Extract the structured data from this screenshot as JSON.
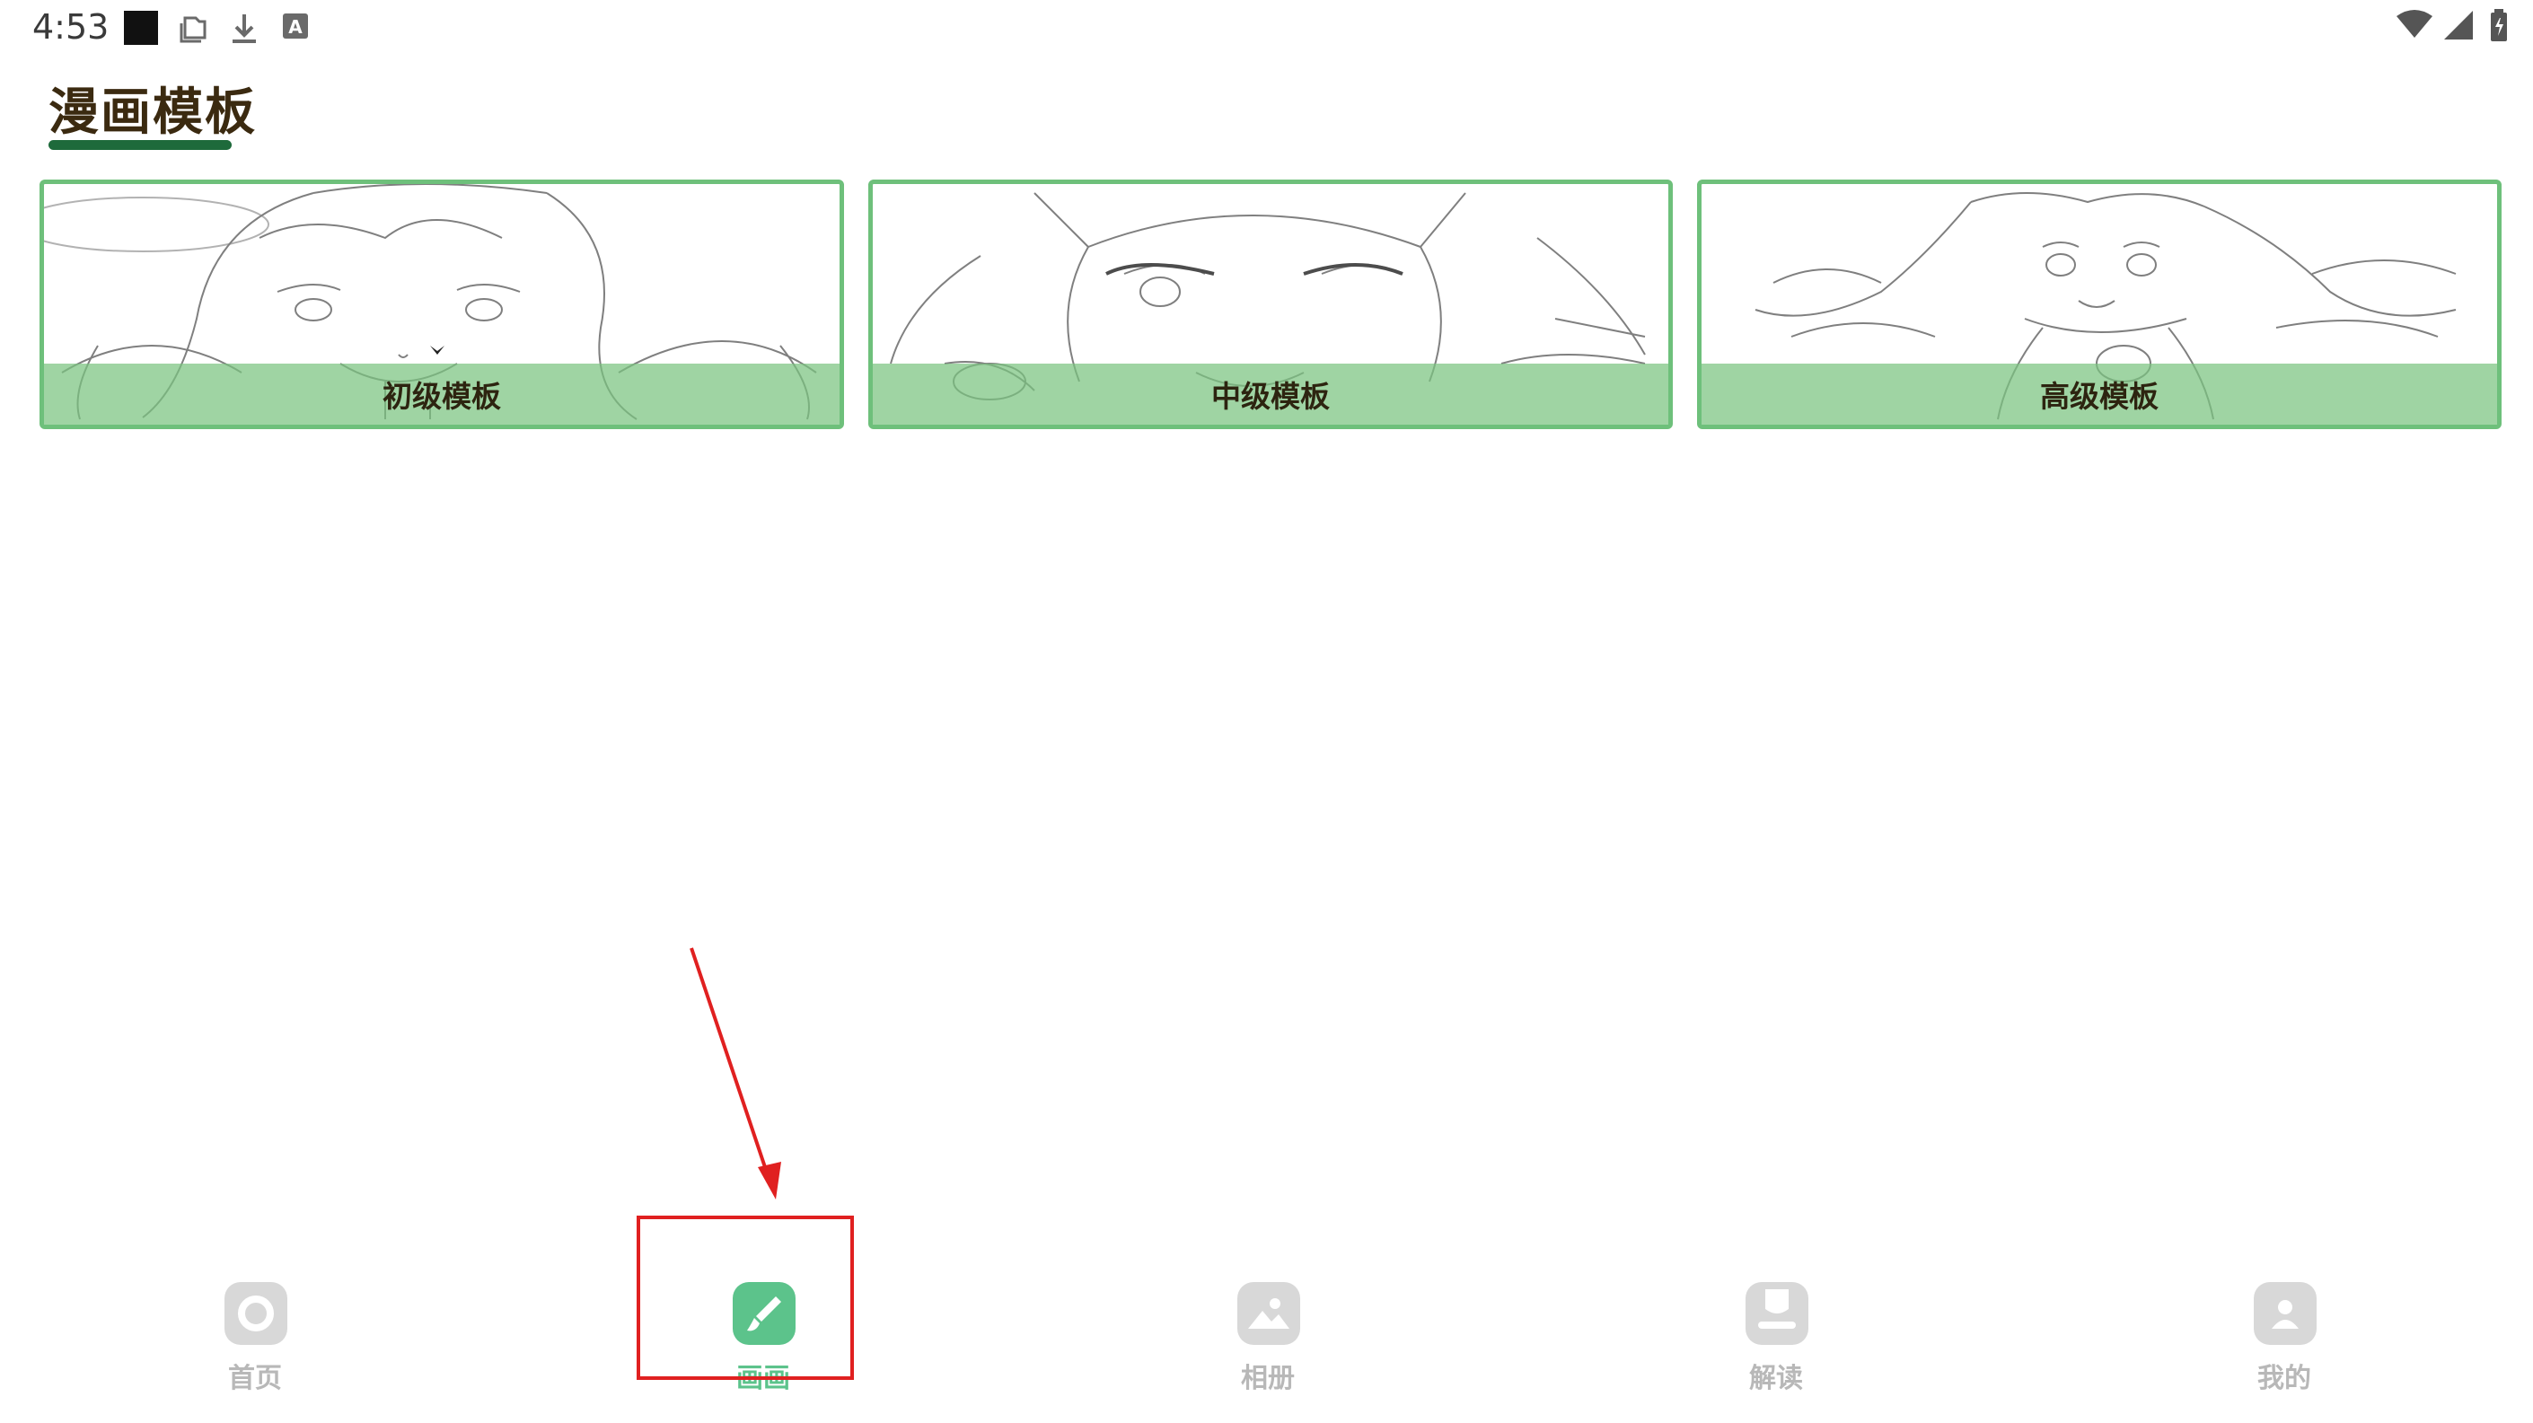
{
  "status_bar": {
    "time": "4:53",
    "left_icons": [
      "black-square-icon",
      "folder-icon",
      "download-icon",
      "keyboard-a-icon"
    ],
    "right_icons": [
      "wifi-icon",
      "cell-signal-icon",
      "battery-icon"
    ]
  },
  "page": {
    "title": "漫画模板"
  },
  "templates": [
    {
      "label": "初级模板",
      "image": "line-art-girl-long-hair"
    },
    {
      "label": "中级模板",
      "image": "line-art-cat-ear-girl"
    },
    {
      "label": "高级模板",
      "image": "line-art-girl-twin-tails"
    }
  ],
  "bottom_nav": {
    "active_index": 1,
    "items": [
      {
        "label": "首页",
        "icon": "home-circle-icon"
      },
      {
        "label": "画画",
        "icon": "brush-icon"
      },
      {
        "label": "相册",
        "icon": "photo-album-icon"
      },
      {
        "label": "解读",
        "icon": "book-icon"
      },
      {
        "label": "我的",
        "icon": "profile-icon"
      }
    ]
  },
  "colors": {
    "accent": "#5cc38b",
    "card_border": "#6ec07b",
    "title_underline": "#1e6a3b",
    "title_text": "#3b2a10",
    "inactive_nav": "#b8b8b8",
    "annotation_red": "#e02020"
  },
  "annotation": {
    "type": "highlight-with-arrow",
    "target": "bottom_nav.items.1"
  }
}
